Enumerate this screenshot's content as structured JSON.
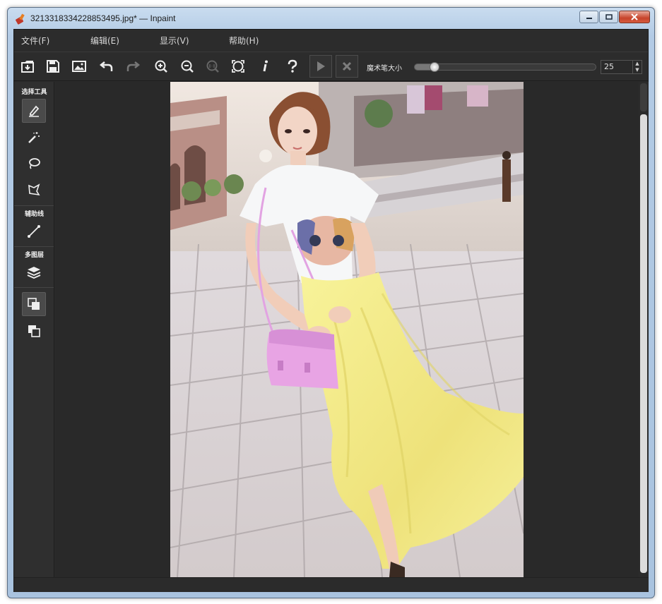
{
  "window": {
    "title": "3213318334228853495.jpg* — Inpaint"
  },
  "menu": {
    "items": [
      "文件(F)",
      "编辑(E)",
      "显示(V)",
      "帮助(H)"
    ]
  },
  "toolbar": {
    "brush_size_label": "魔术笔大小",
    "brush_size_value": "25",
    "brush_size_fraction": 0.06,
    "icons": [
      "open-icon",
      "save-icon",
      "image-icon",
      "undo-icon",
      "redo-icon",
      "zoom-in-icon",
      "zoom-out-icon",
      "actual-size-icon",
      "fit-icon",
      "info-icon",
      "help-icon",
      "play-icon",
      "cancel-icon"
    ]
  },
  "sidebar": {
    "sections": [
      {
        "label": "选择工具",
        "tools": [
          "marker-icon",
          "magic-wand-icon",
          "lasso-icon",
          "polygon-lasso-icon"
        ]
      },
      {
        "label": "辅助线",
        "tools": [
          "line-icon"
        ]
      },
      {
        "label": "多图层",
        "tools": [
          "layers-icon"
        ]
      }
    ],
    "extra_tools": [
      "layer-front-icon",
      "layer-back-icon"
    ]
  },
  "colors": {
    "panel": "#2c2c2c",
    "canvas": "#292929",
    "skirt_yellow": "#f3ef8a",
    "bag_pink": "#e8a4e4"
  }
}
